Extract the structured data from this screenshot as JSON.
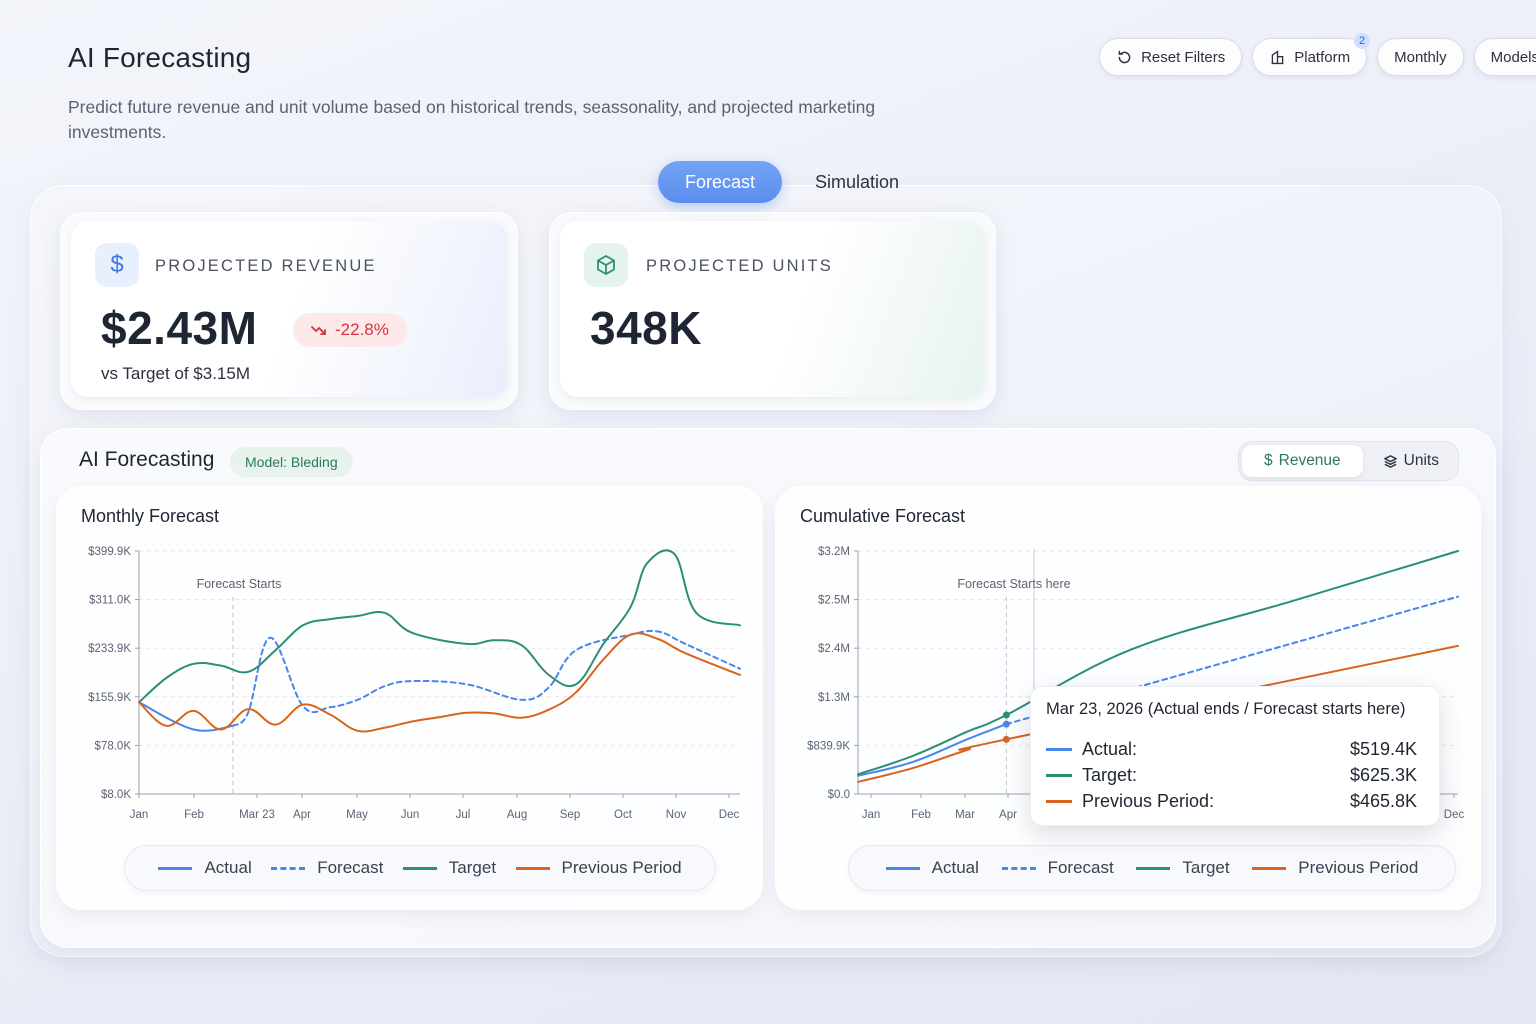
{
  "header": {
    "title": "AI Forecasting",
    "description": "Predict future revenue and unit volume based on historical trends, seassonality, and projected marketing investments."
  },
  "filters": [
    {
      "label": "Reset Filters",
      "icon": "reset-icon"
    },
    {
      "label": "Platform",
      "icon": "platform-icon",
      "badge": "2"
    },
    {
      "label": "Monthly"
    },
    {
      "label": "Models"
    }
  ],
  "tabs": {
    "active": "Forecast",
    "other": "Simulation"
  },
  "kpis": {
    "revenue": {
      "label": "PROJECTED REVENUE",
      "value": "$2.43M",
      "delta": "-22.8%",
      "subtitle": "vs Target of $3.15M",
      "icon": "dollar-icon"
    },
    "units": {
      "label": "PROJECTED UNITS",
      "value": "348K",
      "icon": "box-icon"
    }
  },
  "forecast_panel": {
    "title": "AI Forecasting",
    "model_badge": "Model: Bleding",
    "toggle": {
      "revenue": "Revenue",
      "units": "Units",
      "active": "Revenue"
    }
  },
  "colors": {
    "actual": "#4a86e8",
    "forecast": "#4a86e8",
    "target": "#2b8f74",
    "previous": "#d8651f"
  },
  "legend": {
    "actual": "Actual",
    "forecast": "Forecast",
    "target": "Target",
    "previous": "Previous Period"
  },
  "tooltip": {
    "title": "Mar 23, 2026 (Actual ends / Forecast starts here)",
    "rows": [
      {
        "label": "Actual:",
        "value": "$519.4K"
      },
      {
        "label": "Target:",
        "value": "$625.3K"
      },
      {
        "label": "Previous Period:",
        "value": "$465.8K"
      }
    ]
  },
  "chart_data": [
    {
      "type": "line",
      "title": "Monthly Forecast",
      "annotation": "Forecast Starts",
      "x_ticks": [
        "Jan",
        "Feb",
        "Mar 23",
        "Apr",
        "May",
        "Jun",
        "Jul",
        "Aug",
        "Sep",
        "Oct",
        "Nov",
        "Dec"
      ],
      "y_ticks": [
        "$399.9K",
        "$311.0K",
        "$233.9K",
        "$155.9K",
        "$78.0K",
        "$8.0K"
      ],
      "ylim": [
        8.0,
        399.9
      ],
      "unit": "$K",
      "series": [
        {
          "name": "Actual",
          "x": [
            1,
            2,
            2.72
          ],
          "values": [
            155.9,
            112,
            118
          ]
        },
        {
          "name": "Forecast",
          "x": [
            2.72,
            3,
            3.4,
            4,
            4.5,
            5,
            5.5,
            6,
            7,
            8,
            8.5,
            9,
            10,
            10.5,
            11,
            12
          ],
          "values": [
            118,
            140,
            260,
            150,
            148,
            160,
            182,
            190,
            185,
            160,
            180,
            240,
            265,
            270,
            250,
            210
          ]
        },
        {
          "name": "Target",
          "x": [
            1,
            1.5,
            2,
            2.5,
            3,
            3.5,
            4,
            4.5,
            5,
            5.5,
            6,
            7,
            7.5,
            8,
            8.5,
            9,
            9.5,
            10,
            10.3,
            10.8,
            11.2,
            12
          ],
          "values": [
            155.9,
            195,
            218,
            215,
            205,
            240,
            280,
            290,
            295,
            300,
            268,
            250,
            256,
            248,
            200,
            185,
            250,
            310,
            380,
            395,
            300,
            280
          ]
        },
        {
          "name": "Previous Period",
          "x": [
            1,
            1.5,
            2,
            2.5,
            3,
            3.5,
            4,
            4.5,
            5,
            5.5,
            6,
            6.5,
            7,
            7.5,
            8,
            8.5,
            9,
            9.5,
            10,
            10.5,
            11,
            12
          ],
          "values": [
            155.9,
            118,
            142,
            112,
            145,
            120,
            152,
            136,
            110,
            115,
            125,
            132,
            139,
            138,
            131,
            144,
            172,
            225,
            265,
            258,
            235,
            200
          ]
        }
      ]
    },
    {
      "type": "line",
      "title": "Cumulative Forecast",
      "annotation": "Forecast Starts here",
      "x_ticks": [
        "Jan",
        "Feb",
        "Mar",
        "Apr",
        "Dec"
      ],
      "y_ticks": [
        "$3.2M",
        "$2.5M",
        "$2.4M",
        "$1.3M",
        "$839.9K",
        "$0.0"
      ],
      "ylim": [
        0.0,
        3.2
      ],
      "unit": "$M",
      "series": [
        {
          "name": "Actual",
          "x": [
            1,
            2,
            3,
            3.72
          ],
          "values": [
            0.24,
            0.42,
            0.72,
            0.92
          ]
        },
        {
          "name": "Forecast",
          "x": [
            3.72,
            12
          ],
          "values": [
            0.92,
            2.6
          ]
        },
        {
          "name": "Target",
          "x": [
            1,
            2,
            3,
            3.72,
            6,
            9,
            12
          ],
          "values": [
            0.26,
            0.5,
            0.82,
            1.04,
            1.9,
            2.55,
            3.2
          ]
        },
        {
          "name": "Previous Period",
          "x": [
            1,
            2,
            3,
            3.72,
            12
          ],
          "values": [
            0.16,
            0.34,
            0.58,
            0.72,
            1.95
          ]
        }
      ]
    }
  ]
}
